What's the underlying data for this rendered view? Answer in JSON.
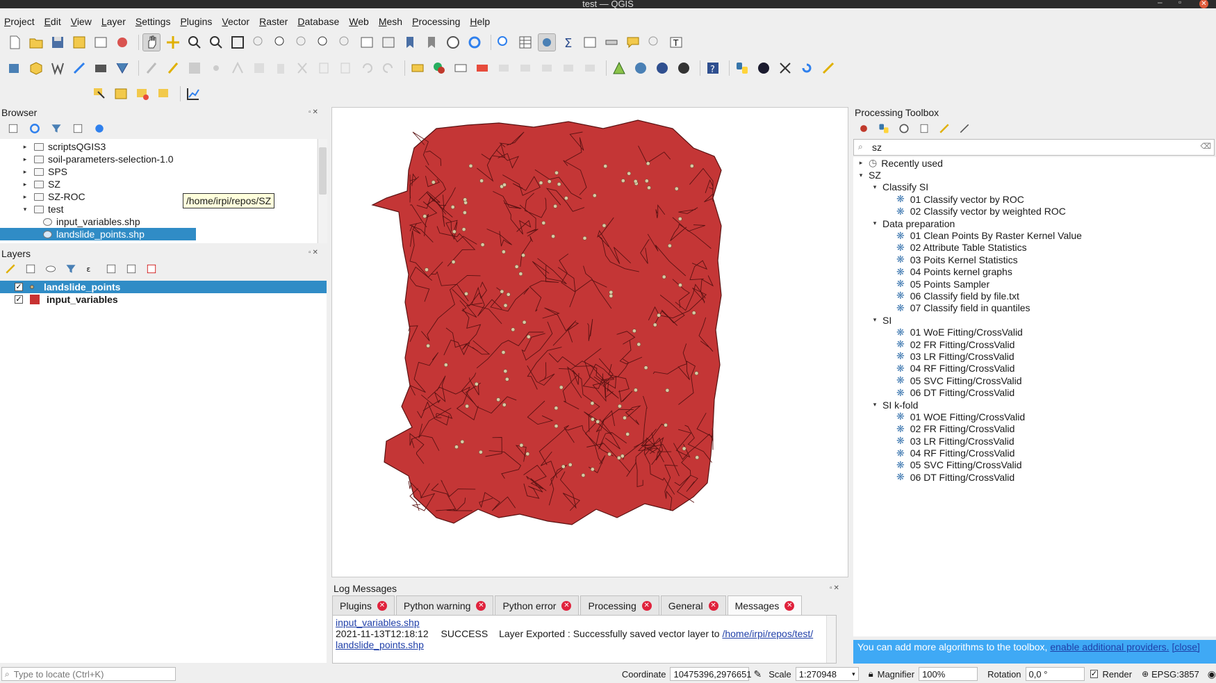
{
  "window": {
    "title": "test — QGIS"
  },
  "menubar": [
    "Project",
    "Edit",
    "View",
    "Layer",
    "Settings",
    "Plugins",
    "Vector",
    "Raster",
    "Database",
    "Web",
    "Mesh",
    "Processing",
    "Help"
  ],
  "browser": {
    "title": "Browser",
    "items": [
      {
        "label": "scriptsQGIS3",
        "kind": "folder",
        "expanded": false
      },
      {
        "label": "soil-parameters-selection-1.0",
        "kind": "folder",
        "expanded": false
      },
      {
        "label": "SPS",
        "kind": "folder",
        "expanded": false
      },
      {
        "label": "SZ",
        "kind": "folder",
        "expanded": false
      },
      {
        "label": "SZ-ROC",
        "kind": "folder",
        "expanded": false
      },
      {
        "label": "test",
        "kind": "folder",
        "expanded": true
      },
      {
        "label": "input_variables.shp",
        "kind": "file",
        "expanded": false
      },
      {
        "label": "landslide_points.shp",
        "kind": "file",
        "expanded": false,
        "selected": true
      }
    ],
    "tooltip": "/home/irpi/repos/SZ"
  },
  "layers": {
    "title": "Layers",
    "items": [
      {
        "label": "landslide_points",
        "checked": true,
        "selected": true,
        "color": "#c8b07a"
      },
      {
        "label": "input_variables",
        "checked": true,
        "selected": false,
        "color": "#c83232"
      }
    ]
  },
  "processing": {
    "title": "Processing Toolbox",
    "search_value": "sz",
    "tree": [
      {
        "label": "Recently used",
        "level": 0,
        "kind": "recent",
        "arrow": "right"
      },
      {
        "label": "SZ",
        "level": 0,
        "kind": "group",
        "arrow": "down"
      },
      {
        "label": "Classify SI",
        "level": 1,
        "kind": "group",
        "arrow": "down"
      },
      {
        "label": "01 Classify vector by ROC",
        "level": 2,
        "kind": "alg"
      },
      {
        "label": "02 Classify vector by weighted ROC",
        "level": 2,
        "kind": "alg"
      },
      {
        "label": "Data preparation",
        "level": 1,
        "kind": "group",
        "arrow": "down"
      },
      {
        "label": "01 Clean Points By Raster Kernel Value",
        "level": 2,
        "kind": "alg"
      },
      {
        "label": "02 Attribute Table Statistics",
        "level": 2,
        "kind": "alg"
      },
      {
        "label": "03 Poits Kernel Statistics",
        "level": 2,
        "kind": "alg"
      },
      {
        "label": "04 Points kernel graphs",
        "level": 2,
        "kind": "alg"
      },
      {
        "label": "05 Points Sampler",
        "level": 2,
        "kind": "alg"
      },
      {
        "label": "06 Classify field by file.txt",
        "level": 2,
        "kind": "alg"
      },
      {
        "label": "07 Classify field in quantiles",
        "level": 2,
        "kind": "alg"
      },
      {
        "label": "SI",
        "level": 1,
        "kind": "group",
        "arrow": "down"
      },
      {
        "label": "01 WoE Fitting/CrossValid",
        "level": 2,
        "kind": "alg"
      },
      {
        "label": "02 FR Fitting/CrossValid",
        "level": 2,
        "kind": "alg"
      },
      {
        "label": "03 LR Fitting/CrossValid",
        "level": 2,
        "kind": "alg"
      },
      {
        "label": "04 RF Fitting/CrossValid",
        "level": 2,
        "kind": "alg"
      },
      {
        "label": "05 SVC Fitting/CrossValid",
        "level": 2,
        "kind": "alg"
      },
      {
        "label": "06 DT Fitting/CrossValid",
        "level": 2,
        "kind": "alg"
      },
      {
        "label": "SI k-fold",
        "level": 1,
        "kind": "group",
        "arrow": "down"
      },
      {
        "label": "01 WOE Fitting/CrossValid",
        "level": 2,
        "kind": "alg"
      },
      {
        "label": "02 FR Fitting/CrossValid",
        "level": 2,
        "kind": "alg"
      },
      {
        "label": "03 LR Fitting/CrossValid",
        "level": 2,
        "kind": "alg"
      },
      {
        "label": "04 RF Fitting/CrossValid",
        "level": 2,
        "kind": "alg"
      },
      {
        "label": "05 SVC Fitting/CrossValid",
        "level": 2,
        "kind": "alg"
      },
      {
        "label": "06 DT Fitting/CrossValid",
        "level": 2,
        "kind": "alg"
      }
    ],
    "info_text": "You can add more algorithms to the toolbox,",
    "info_link": "enable additional providers.",
    "info_close": "[close]"
  },
  "log": {
    "title": "Log Messages",
    "tabs": [
      "Plugins",
      "Python warning",
      "Python error",
      "Processing",
      "General",
      "Messages"
    ],
    "active_tab": "Messages",
    "entry": {
      "link1": "input_variables.shp",
      "timestamp": "2021-11-13T12:18:12",
      "level": "SUCCESS",
      "message": "Layer Exported : Successfully saved vector layer to",
      "path": "/home/irpi/repos/test/",
      "link2": "landslide_points.shp"
    }
  },
  "statusbar": {
    "locator_placeholder": "Type to locate (Ctrl+K)",
    "coordinate_label": "Coordinate",
    "coordinate_value": "10475396,2976651",
    "scale_label": "Scale",
    "scale_value": "1:270948",
    "magnifier_label": "Magnifier",
    "magnifier_value": "100%",
    "rotation_label": "Rotation",
    "rotation_value": "0,0 °",
    "render_label": "Render",
    "crs": "EPSG:3857"
  },
  "colors": {
    "polygon_fill": "#c43636",
    "point_fill": "#d8c9a3",
    "selection": "#308cc6",
    "info_bar": "#3fa9f5"
  }
}
